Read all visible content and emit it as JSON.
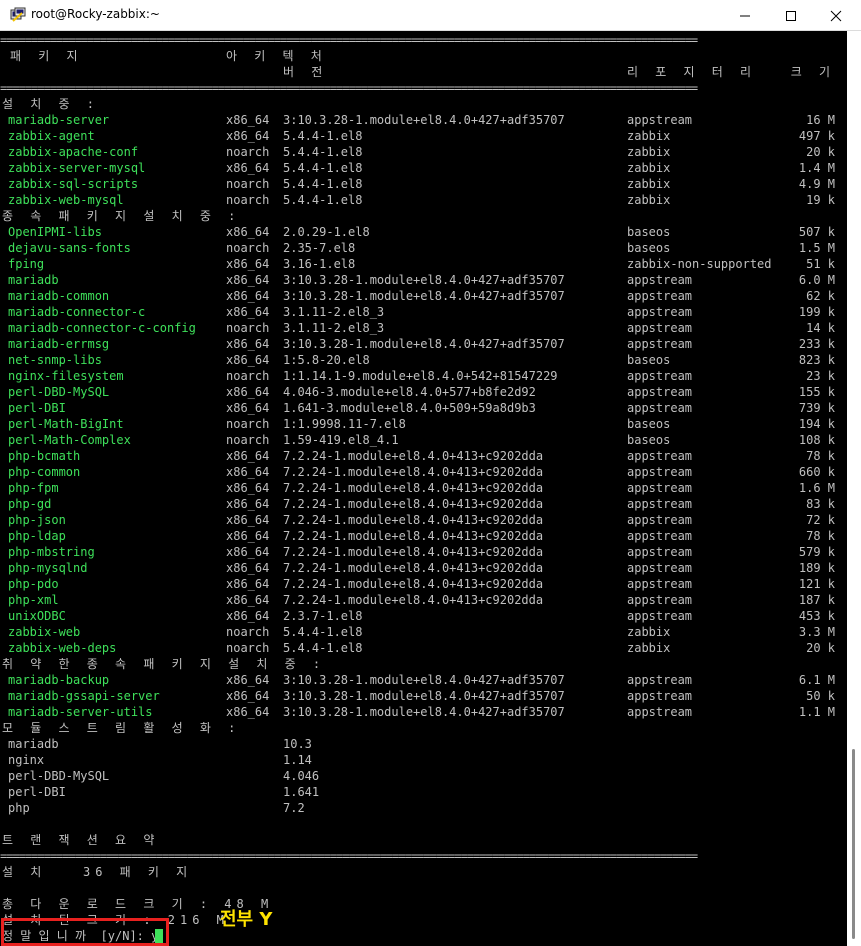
{
  "window": {
    "title": "root@Rocky-zabbix:~",
    "controls": {
      "minimize": "minimize-icon",
      "maximize": "maximize-icon",
      "close": "close-icon"
    }
  },
  "colors": {
    "terminal_bg": "#000000",
    "terminal_text": "#c0c0c0",
    "package_name": "#3ee05a",
    "highlight_box": "#e8211f",
    "annotation": "#ffe300"
  },
  "terminal": {
    "separator": "================================================================================================================",
    "headers": {
      "package": "패 키 지",
      "arch": "아 키 텍 처",
      "version": "버 전",
      "repo": "리 포 지 터 리",
      "size": "크 기"
    },
    "section_install": "설 치 중 :",
    "install_packages": [
      [
        "mariadb-server",
        "x86_64",
        "3:10.3.28-1.module+el8.4.0+427+adf35707",
        "appstream",
        "16 M"
      ],
      [
        "zabbix-agent",
        "x86_64",
        "5.4.4-1.el8",
        "zabbix",
        "497 k"
      ],
      [
        "zabbix-apache-conf",
        "noarch",
        "5.4.4-1.el8",
        "zabbix",
        "20 k"
      ],
      [
        "zabbix-server-mysql",
        "x86_64",
        "5.4.4-1.el8",
        "zabbix",
        "1.4 M"
      ],
      [
        "zabbix-sql-scripts",
        "noarch",
        "5.4.4-1.el8",
        "zabbix",
        "4.9 M"
      ],
      [
        "zabbix-web-mysql",
        "noarch",
        "5.4.4-1.el8",
        "zabbix",
        "19 k"
      ]
    ],
    "section_deps": "종 속 패 키 지 설 치 중 :",
    "dep_packages": [
      [
        "OpenIPMI-libs",
        "x86_64",
        "2.0.29-1.el8",
        "baseos",
        "507 k"
      ],
      [
        "dejavu-sans-fonts",
        "noarch",
        "2.35-7.el8",
        "baseos",
        "1.5 M"
      ],
      [
        "fping",
        "x86_64",
        "3.16-1.el8",
        "zabbix-non-supported",
        "51 k"
      ],
      [
        "mariadb",
        "x86_64",
        "3:10.3.28-1.module+el8.4.0+427+adf35707",
        "appstream",
        "6.0 M"
      ],
      [
        "mariadb-common",
        "x86_64",
        "3:10.3.28-1.module+el8.4.0+427+adf35707",
        "appstream",
        "62 k"
      ],
      [
        "mariadb-connector-c",
        "x86_64",
        "3.1.11-2.el8_3",
        "appstream",
        "199 k"
      ],
      [
        "mariadb-connector-c-config",
        "noarch",
        "3.1.11-2.el8_3",
        "appstream",
        "14 k"
      ],
      [
        "mariadb-errmsg",
        "x86_64",
        "3:10.3.28-1.module+el8.4.0+427+adf35707",
        "appstream",
        "233 k"
      ],
      [
        "net-snmp-libs",
        "x86_64",
        "1:5.8-20.el8",
        "baseos",
        "823 k"
      ],
      [
        "nginx-filesystem",
        "noarch",
        "1:1.14.1-9.module+el8.4.0+542+81547229",
        "appstream",
        "23 k"
      ],
      [
        "perl-DBD-MySQL",
        "x86_64",
        "4.046-3.module+el8.4.0+577+b8fe2d92",
        "appstream",
        "155 k"
      ],
      [
        "perl-DBI",
        "x86_64",
        "1.641-3.module+el8.4.0+509+59a8d9b3",
        "appstream",
        "739 k"
      ],
      [
        "perl-Math-BigInt",
        "noarch",
        "1:1.9998.11-7.el8",
        "baseos",
        "194 k"
      ],
      [
        "perl-Math-Complex",
        "noarch",
        "1.59-419.el8_4.1",
        "baseos",
        "108 k"
      ],
      [
        "php-bcmath",
        "x86_64",
        "7.2.24-1.module+el8.4.0+413+c9202dda",
        "appstream",
        "78 k"
      ],
      [
        "php-common",
        "x86_64",
        "7.2.24-1.module+el8.4.0+413+c9202dda",
        "appstream",
        "660 k"
      ],
      [
        "php-fpm",
        "x86_64",
        "7.2.24-1.module+el8.4.0+413+c9202dda",
        "appstream",
        "1.6 M"
      ],
      [
        "php-gd",
        "x86_64",
        "7.2.24-1.module+el8.4.0+413+c9202dda",
        "appstream",
        "83 k"
      ],
      [
        "php-json",
        "x86_64",
        "7.2.24-1.module+el8.4.0+413+c9202dda",
        "appstream",
        "72 k"
      ],
      [
        "php-ldap",
        "x86_64",
        "7.2.24-1.module+el8.4.0+413+c9202dda",
        "appstream",
        "78 k"
      ],
      [
        "php-mbstring",
        "x86_64",
        "7.2.24-1.module+el8.4.0+413+c9202dda",
        "appstream",
        "579 k"
      ],
      [
        "php-mysqlnd",
        "x86_64",
        "7.2.24-1.module+el8.4.0+413+c9202dda",
        "appstream",
        "189 k"
      ],
      [
        "php-pdo",
        "x86_64",
        "7.2.24-1.module+el8.4.0+413+c9202dda",
        "appstream",
        "121 k"
      ],
      [
        "php-xml",
        "x86_64",
        "7.2.24-1.module+el8.4.0+413+c9202dda",
        "appstream",
        "187 k"
      ],
      [
        "unixODBC",
        "x86_64",
        "2.3.7-1.el8",
        "appstream",
        "453 k"
      ],
      [
        "zabbix-web",
        "noarch",
        "5.4.4-1.el8",
        "zabbix",
        "3.3 M"
      ],
      [
        "zabbix-web-deps",
        "noarch",
        "5.4.4-1.el8",
        "zabbix",
        "20 k"
      ]
    ],
    "section_weak": "취 약 한 종 속 패 키 지 설 치 중 :",
    "weak_packages": [
      [
        "mariadb-backup",
        "x86_64",
        "3:10.3.28-1.module+el8.4.0+427+adf35707",
        "appstream",
        "6.1 M"
      ],
      [
        "mariadb-gssapi-server",
        "x86_64",
        "3:10.3.28-1.module+el8.4.0+427+adf35707",
        "appstream",
        "50 k"
      ],
      [
        "mariadb-server-utils",
        "x86_64",
        "3:10.3.28-1.module+el8.4.0+427+adf35707",
        "appstream",
        "1.1 M"
      ]
    ],
    "section_modules": "모 듈 스 트 림 활 성 화 :",
    "module_streams": [
      [
        "mariadb",
        "10.3"
      ],
      [
        "nginx",
        "1.14"
      ],
      [
        "perl-DBD-MySQL",
        "4.046"
      ],
      [
        "perl-DBI",
        "1.641"
      ],
      [
        "php",
        "7.2"
      ]
    ],
    "section_summary": "트 랜 잭 션 요 약",
    "install_count": "설 치   36 패 키 지",
    "download_size": "총 다 운 로 드 크 기 : 48 M",
    "installed_size": "설 치 된 크 기 : 216 M",
    "prompt": "정 말 입 니 까  [y/N]: y"
  },
  "annotation": {
    "text": "전부 Y"
  }
}
